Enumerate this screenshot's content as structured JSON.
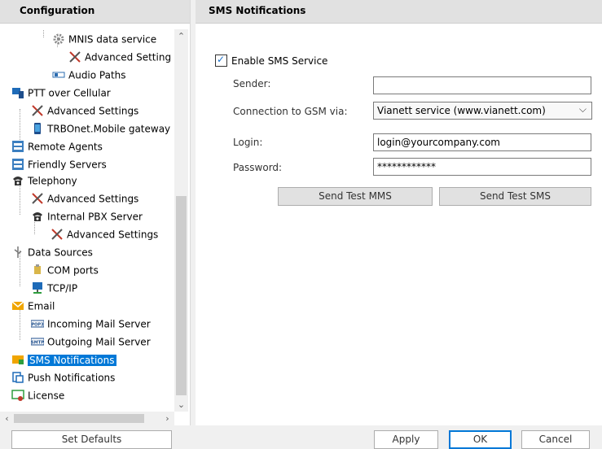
{
  "left_header": "Configuration",
  "right_header": "SMS Notifications",
  "tree": [
    {
      "label": "MNIS data service",
      "icon": "gear-icon"
    },
    {
      "label": "Advanced Setting",
      "icon": "tools-icon"
    },
    {
      "label": "Audio Paths",
      "icon": "audio-path-icon"
    },
    {
      "label": "PTT over Cellular",
      "icon": "cellular-icon"
    },
    {
      "label": "Advanced Settings",
      "icon": "tools-icon"
    },
    {
      "label": "TRBOnet.Mobile gateway",
      "icon": "mobile-icon"
    },
    {
      "label": "Remote Agents",
      "icon": "remote-agents-icon"
    },
    {
      "label": "Friendly Servers",
      "icon": "servers-icon"
    },
    {
      "label": "Telephony",
      "icon": "telephone-icon"
    },
    {
      "label": "Advanced Settings",
      "icon": "tools-icon"
    },
    {
      "label": "Internal PBX Server",
      "icon": "telephone-icon"
    },
    {
      "label": "Advanced Settings",
      "icon": "tools-icon"
    },
    {
      "label": "Data Sources",
      "icon": "usb-icon"
    },
    {
      "label": "COM ports",
      "icon": "com-port-icon"
    },
    {
      "label": "TCP/IP",
      "icon": "network-icon"
    },
    {
      "label": "Email",
      "icon": "email-icon"
    },
    {
      "label": "Incoming Mail Server",
      "icon": "pop3-icon"
    },
    {
      "label": "Outgoing Mail Server",
      "icon": "smtp-icon"
    },
    {
      "label": "SMS Notifications",
      "icon": "sms-icon"
    },
    {
      "label": "Push Notifications",
      "icon": "push-icon"
    },
    {
      "label": "License",
      "icon": "license-icon"
    }
  ],
  "form": {
    "enable_label": "Enable SMS Service",
    "enable_checked": true,
    "sender_label": "Sender:",
    "sender_value": "",
    "gsm_label": "Connection to GSM via:",
    "gsm_value": "Vianett service (www.vianett.com)",
    "login_label": "Login:",
    "login_value": "login@yourcompany.com",
    "password_label": "Password:",
    "password_value": "************",
    "send_test_mms": "Send Test MMS",
    "send_test_sms": "Send Test SMS"
  },
  "footer": {
    "set_defaults": "Set Defaults",
    "apply": "Apply",
    "ok": "OK",
    "cancel": "Cancel"
  },
  "colors": {
    "selection": "#0078d7",
    "header_bg": "#e1e1e1"
  }
}
